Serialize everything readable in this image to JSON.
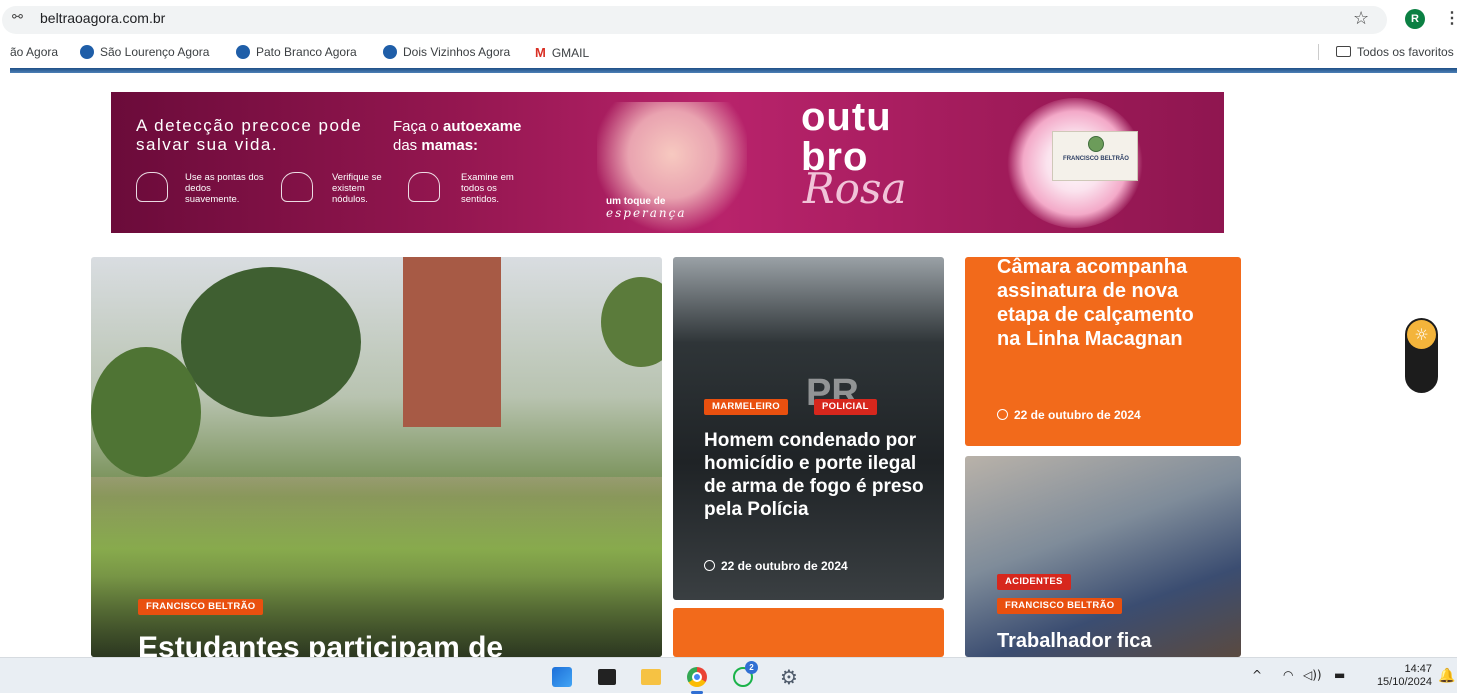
{
  "browser": {
    "url": "beltraoagora.com.br",
    "site_icon": "⚯",
    "star_icon": "☆",
    "avatar_letter": "R",
    "menu_icon": "⋮",
    "bookmarks": [
      {
        "label": "ão Agora",
        "icon_color": ""
      },
      {
        "label": "São Lourenço Agora",
        "icon_color": "#1f5ea8"
      },
      {
        "label": "Pato Branco Agora",
        "icon_color": "#1f5ea8"
      },
      {
        "label": "Dois Vizinhos Agora",
        "icon_color": "#1f5ea8"
      },
      {
        "label": "GMAIL",
        "icon_color": "#d93025"
      }
    ],
    "all_bookmarks": "Todos os favoritos"
  },
  "banner": {
    "headline": "A detecção precoce pode salvar sua vida.",
    "cta_pre": "Faça o ",
    "cta_bold": "autoexame",
    "cta_line2_pre": "das ",
    "cta_line2_bold": "mamas:",
    "hints": [
      "Use as pontas dos dedos suavemente.",
      "Verifique se existem nódulos.",
      "Examine em todos os sentidos."
    ],
    "tagline": "um toque de",
    "tagline2": "esperança",
    "campaign_1": "outu",
    "campaign_2": "bro",
    "campaign_3": "Rosa",
    "seal_text": "FRANCISCO BELTRÃO"
  },
  "news": {
    "main": {
      "category": "FRANCISCO BELTRÃO",
      "headline": "Estudantes participam de"
    },
    "police": {
      "categories": [
        "MARMELEIRO",
        "POLICIAL"
      ],
      "plate": "PR",
      "headline": "Homem condenado por homicídio e porte ilegal de arma de fogo é preso pela Polícia",
      "date": "22 de outubro de 2024"
    },
    "council": {
      "headline": "Câmara acompanha assinatura de nova etapa de calçamento na Linha Macagnan",
      "date": "22 de outubro de 2024"
    },
    "accident": {
      "categories": [
        "ACIDENTES",
        "FRANCISCO BELTRÃO"
      ],
      "headline": "Trabalhador fica"
    }
  },
  "theme_toggle_icon": "☼",
  "taskbar": {
    "whatsapp_count": "2",
    "gear_icon": "⚙",
    "tray_chevron": "^",
    "wifi_icon": "◠",
    "volume_icon": "◁))",
    "battery_icon": "▬",
    "time": "14:47",
    "date": "15/10/2024",
    "bell_icon": "🔔"
  }
}
